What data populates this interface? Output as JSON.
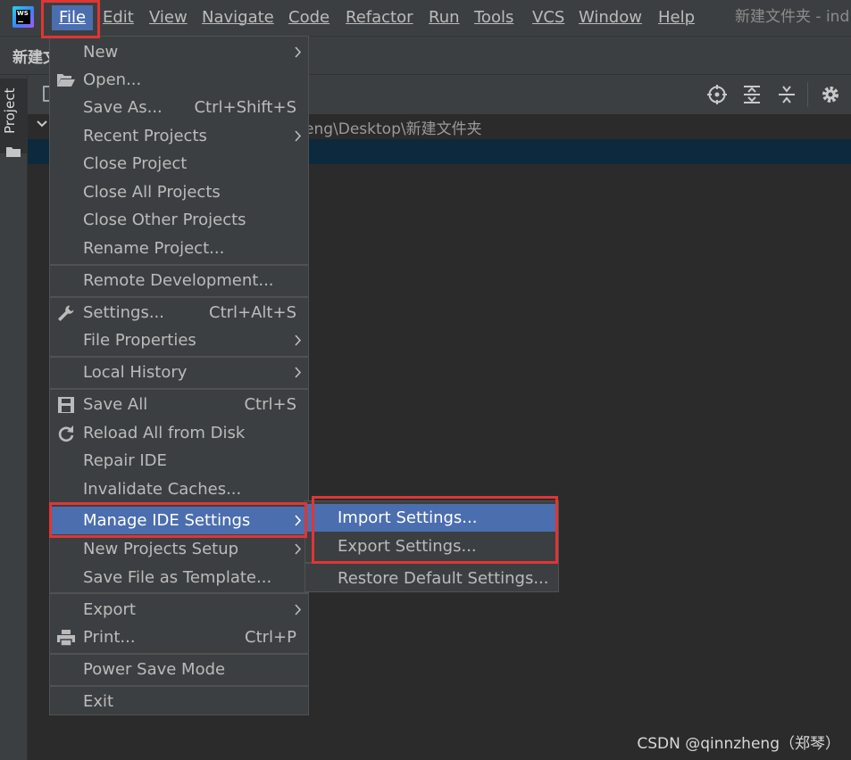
{
  "menubar": {
    "items": [
      {
        "label": "File"
      },
      {
        "label": "Edit"
      },
      {
        "label": "View"
      },
      {
        "label": "Navigate"
      },
      {
        "label": "Code"
      },
      {
        "label": "Refactor"
      },
      {
        "label": "Run"
      },
      {
        "label": "Tools"
      },
      {
        "label": "VCS"
      },
      {
        "label": "Window"
      },
      {
        "label": "Help"
      }
    ],
    "window_title": "新建文件夹 - ind",
    "logo_text": "WS"
  },
  "navbar": {
    "crumb": "新建文"
  },
  "tool_window": {
    "tab_label": "Project"
  },
  "project_panel": {
    "path_text": "eng\\Desktop\\新建文件夹"
  },
  "file_menu": {
    "items": [
      {
        "label": "New",
        "has_submenu": true
      },
      {
        "label": "Open...",
        "icon": "folder-open-icon"
      },
      {
        "label": "Save As...",
        "shortcut": "Ctrl+Shift+S"
      },
      {
        "label": "Recent Projects",
        "has_submenu": true
      },
      {
        "label": "Close Project"
      },
      {
        "label": "Close All Projects"
      },
      {
        "label": "Close Other Projects"
      },
      {
        "label": "Rename Project..."
      },
      {
        "label": "Remote Development..."
      },
      {
        "label": "Settings...",
        "shortcut": "Ctrl+Alt+S",
        "icon": "wrench-icon"
      },
      {
        "label": "File Properties",
        "has_submenu": true
      },
      {
        "label": "Local History",
        "has_submenu": true
      },
      {
        "label": "Save All",
        "shortcut": "Ctrl+S",
        "icon": "save-icon"
      },
      {
        "label": "Reload All from Disk",
        "icon": "reload-icon"
      },
      {
        "label": "Repair IDE"
      },
      {
        "label": "Invalidate Caches..."
      },
      {
        "label": "Manage IDE Settings",
        "has_submenu": true,
        "highlighted": true
      },
      {
        "label": "New Projects Setup",
        "has_submenu": true
      },
      {
        "label": "Save File as Template..."
      },
      {
        "label": "Export",
        "has_submenu": true
      },
      {
        "label": "Print...",
        "shortcut": "Ctrl+P",
        "icon": "printer-icon"
      },
      {
        "label": "Power Save Mode"
      },
      {
        "label": "Exit"
      }
    ]
  },
  "settings_submenu": {
    "items": [
      {
        "label": "Import Settings...",
        "highlighted": true
      },
      {
        "label": "Export Settings..."
      },
      {
        "label": "Restore Default Settings..."
      }
    ]
  },
  "watermark": "CSDN @qinnzheng（郑琴）",
  "colors": {
    "menu_bg": "#3c3f41",
    "editor_bg": "#2b2b2b",
    "highlight": "#4b6eaf",
    "annotation_red": "#e03535",
    "selection_row": "#0d293e"
  }
}
